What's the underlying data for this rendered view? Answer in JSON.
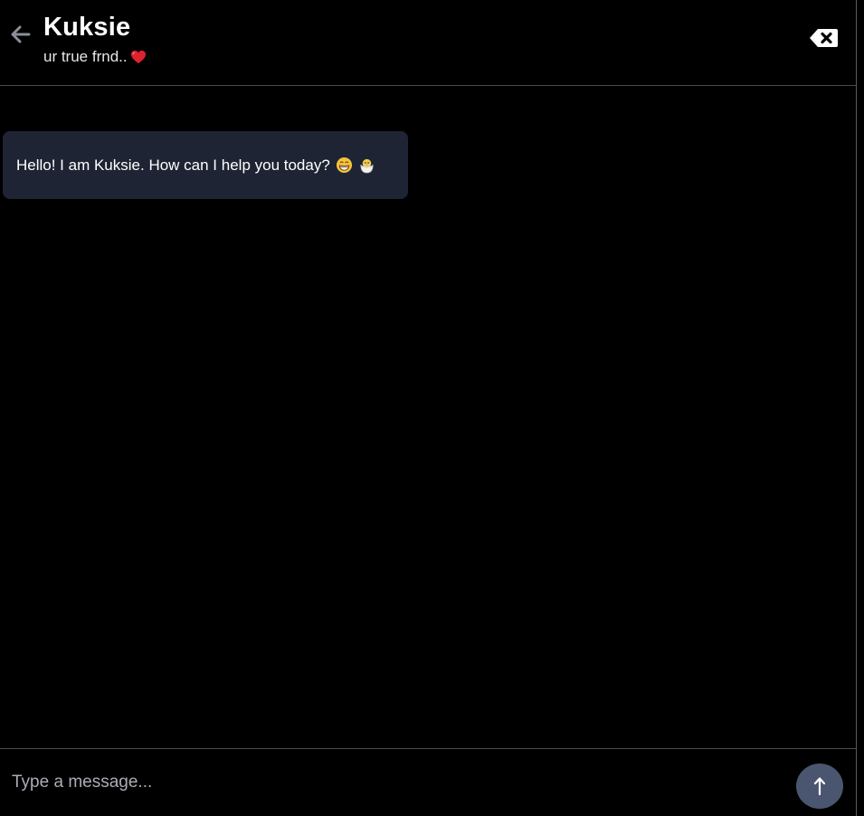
{
  "header": {
    "title": "Kuksie",
    "subtitle": "ur true frnd..",
    "back_icon": "arrow-left-icon",
    "subtitle_icon": "red-heart-icon",
    "clear_icon": "backspace-x-icon"
  },
  "messages": [
    {
      "sender": "bot",
      "text": "Hello! I am Kuksie. How can I help you today?",
      "emojis": [
        "grinning-face-icon",
        "hatching-chick-icon"
      ]
    }
  ],
  "composer": {
    "placeholder": "Type a message...",
    "value": "",
    "send_icon": "arrow-up-icon"
  },
  "colors": {
    "background": "#000000",
    "bubble": "#1e2433",
    "send_button": "#4a5670",
    "divider": "#4b4b4b",
    "placeholder": "#a9adb5",
    "heart": "#e0212f"
  }
}
